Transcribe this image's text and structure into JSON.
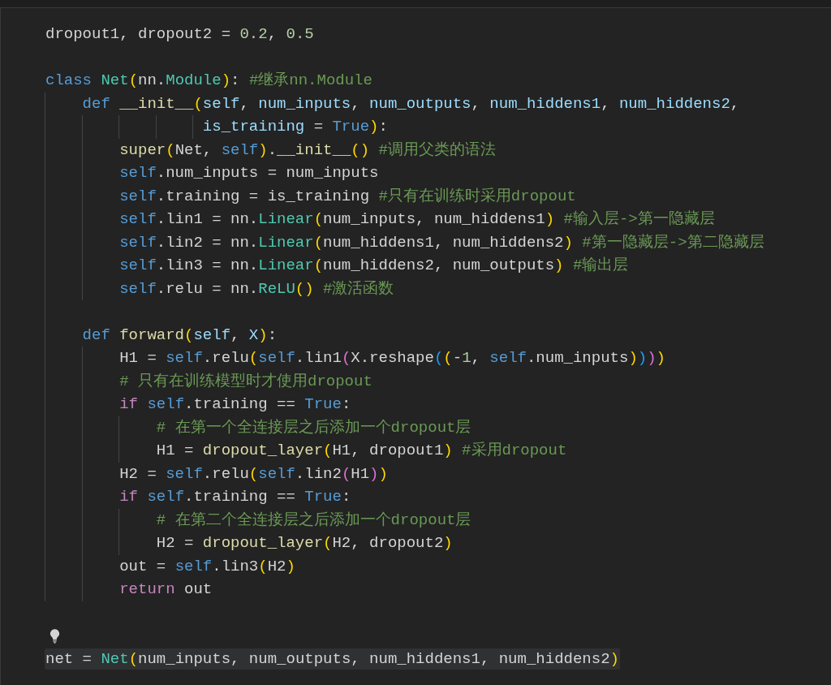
{
  "editor": {
    "lines": [
      {
        "kind": "code",
        "selected": false,
        "tokens": [
          {
            "text": "dropout1, dropout2 = ",
            "kind": "plain"
          },
          {
            "text": "0.2",
            "kind": "num"
          },
          {
            "text": ", ",
            "kind": "plain"
          },
          {
            "text": "0.5",
            "kind": "num"
          }
        ]
      },
      {
        "kind": "blank"
      },
      {
        "kind": "code",
        "selected": false,
        "tokens": [
          {
            "text": "class ",
            "kind": "kw"
          },
          {
            "text": "Net",
            "kind": "cls"
          },
          {
            "text": "(",
            "kind": "b1"
          },
          {
            "text": "nn.",
            "kind": "plain"
          },
          {
            "text": "Module",
            "kind": "cls"
          },
          {
            "text": ")",
            "kind": "b1"
          },
          {
            "text": ": ",
            "kind": "plain"
          },
          {
            "text": "#继承nn.Module",
            "kind": "cm"
          }
        ],
        "children": [
          {
            "kind": "code",
            "selected": false,
            "tokens": [
              {
                "text": "def ",
                "kind": "kw"
              },
              {
                "text": "__init__",
                "kind": "fn"
              },
              {
                "text": "(",
                "kind": "b1"
              },
              {
                "text": "self",
                "kind": "var"
              },
              {
                "text": ", ",
                "kind": "plain"
              },
              {
                "text": "num_inputs",
                "kind": "var"
              },
              {
                "text": ", ",
                "kind": "plain"
              },
              {
                "text": "num_outputs",
                "kind": "var"
              },
              {
                "text": ", ",
                "kind": "plain"
              },
              {
                "text": "num_hiddens1",
                "kind": "var"
              },
              {
                "text": ", ",
                "kind": "plain"
              },
              {
                "text": "num_hiddens2",
                "kind": "var"
              },
              {
                "text": ",",
                "kind": "plain"
              }
            ],
            "children": [
              {
                "kind": "continuation",
                "selected": false,
                "tokens": [
                  {
                    "text": "is_training",
                    "kind": "var"
                  },
                  {
                    "text": " = ",
                    "kind": "plain"
                  },
                  {
                    "text": "True",
                    "kind": "kw"
                  },
                  {
                    "text": ")",
                    "kind": "b1"
                  },
                  {
                    "text": ":",
                    "kind": "plain"
                  }
                ]
              },
              {
                "kind": "code",
                "selected": false,
                "tokens": [
                  {
                    "text": "super",
                    "kind": "fn"
                  },
                  {
                    "text": "(",
                    "kind": "b1"
                  },
                  {
                    "text": "Net, ",
                    "kind": "plain"
                  },
                  {
                    "text": "self",
                    "kind": "kw"
                  },
                  {
                    "text": ")",
                    "kind": "b1"
                  },
                  {
                    "text": ".",
                    "kind": "plain"
                  },
                  {
                    "text": "__init__",
                    "kind": "fn"
                  },
                  {
                    "text": "() ",
                    "kind": "b1"
                  },
                  {
                    "text": "#调用父类的语法",
                    "kind": "cm"
                  }
                ]
              },
              {
                "kind": "code",
                "selected": false,
                "tokens": [
                  {
                    "text": "self",
                    "kind": "kw"
                  },
                  {
                    "text": ".num_inputs = num_inputs",
                    "kind": "plain"
                  }
                ]
              },
              {
                "kind": "code",
                "selected": false,
                "tokens": [
                  {
                    "text": "self",
                    "kind": "kw"
                  },
                  {
                    "text": ".training = is_training ",
                    "kind": "plain"
                  },
                  {
                    "text": "#只有在训练时采用dropout",
                    "kind": "cm"
                  }
                ]
              },
              {
                "kind": "code",
                "selected": false,
                "tokens": [
                  {
                    "text": "self",
                    "kind": "kw"
                  },
                  {
                    "text": ".lin1 = nn.",
                    "kind": "plain"
                  },
                  {
                    "text": "Linear",
                    "kind": "cls"
                  },
                  {
                    "text": "(",
                    "kind": "b1"
                  },
                  {
                    "text": "num_inputs, num_hiddens1",
                    "kind": "plain"
                  },
                  {
                    "text": ") ",
                    "kind": "b1"
                  },
                  {
                    "text": "#输入层->第一隐藏层",
                    "kind": "cm"
                  }
                ]
              },
              {
                "kind": "code",
                "selected": false,
                "tokens": [
                  {
                    "text": "self",
                    "kind": "kw"
                  },
                  {
                    "text": ".lin2 = nn.",
                    "kind": "plain"
                  },
                  {
                    "text": "Linear",
                    "kind": "cls"
                  },
                  {
                    "text": "(",
                    "kind": "b1"
                  },
                  {
                    "text": "num_hiddens1, num_hiddens2",
                    "kind": "plain"
                  },
                  {
                    "text": ") ",
                    "kind": "b1"
                  },
                  {
                    "text": "#第一隐藏层->第二隐藏层",
                    "kind": "cm"
                  }
                ]
              },
              {
                "kind": "code",
                "selected": false,
                "tokens": [
                  {
                    "text": "self",
                    "kind": "kw"
                  },
                  {
                    "text": ".lin3 = nn.",
                    "kind": "plain"
                  },
                  {
                    "text": "Linear",
                    "kind": "cls"
                  },
                  {
                    "text": "(",
                    "kind": "b1"
                  },
                  {
                    "text": "num_hiddens2, num_outputs",
                    "kind": "plain"
                  },
                  {
                    "text": ") ",
                    "kind": "b1"
                  },
                  {
                    "text": "#输出层",
                    "kind": "cm"
                  }
                ]
              },
              {
                "kind": "code",
                "selected": false,
                "tokens": [
                  {
                    "text": "self",
                    "kind": "kw"
                  },
                  {
                    "text": ".relu = nn.",
                    "kind": "plain"
                  },
                  {
                    "text": "ReLU",
                    "kind": "cls"
                  },
                  {
                    "text": "() ",
                    "kind": "b1"
                  },
                  {
                    "text": "#激活函数",
                    "kind": "cm"
                  }
                ]
              }
            ]
          },
          {
            "kind": "blank"
          },
          {
            "kind": "code",
            "selected": false,
            "tokens": [
              {
                "text": "def ",
                "kind": "kw"
              },
              {
                "text": "forward",
                "kind": "fn"
              },
              {
                "text": "(",
                "kind": "b1"
              },
              {
                "text": "self",
                "kind": "var"
              },
              {
                "text": ", ",
                "kind": "plain"
              },
              {
                "text": "X",
                "kind": "var"
              },
              {
                "text": ")",
                "kind": "b1"
              },
              {
                "text": ":",
                "kind": "plain"
              }
            ],
            "children": [
              {
                "kind": "code",
                "selected": false,
                "tokens": [
                  {
                    "text": "H1 = ",
                    "kind": "plain"
                  },
                  {
                    "text": "self",
                    "kind": "kw"
                  },
                  {
                    "text": ".relu",
                    "kind": "plain"
                  },
                  {
                    "text": "(",
                    "kind": "b1"
                  },
                  {
                    "text": "self",
                    "kind": "kw"
                  },
                  {
                    "text": ".lin1",
                    "kind": "plain"
                  },
                  {
                    "text": "(",
                    "kind": "b2"
                  },
                  {
                    "text": "X.reshape",
                    "kind": "plain"
                  },
                  {
                    "text": "(",
                    "kind": "b3"
                  },
                  {
                    "text": "(",
                    "kind": "b1"
                  },
                  {
                    "text": "-",
                    "kind": "plain"
                  },
                  {
                    "text": "1",
                    "kind": "num"
                  },
                  {
                    "text": ", ",
                    "kind": "plain"
                  },
                  {
                    "text": "self",
                    "kind": "kw"
                  },
                  {
                    "text": ".num_inputs",
                    "kind": "plain"
                  },
                  {
                    "text": ")",
                    "kind": "b1"
                  },
                  {
                    "text": ")",
                    "kind": "b3"
                  },
                  {
                    "text": ")",
                    "kind": "b2"
                  },
                  {
                    "text": ")",
                    "kind": "b1"
                  }
                ]
              },
              {
                "kind": "code",
                "selected": false,
                "tokens": [
                  {
                    "text": "# 只有在训练模型时才使用dropout",
                    "kind": "cm"
                  }
                ]
              },
              {
                "kind": "code",
                "selected": false,
                "tokens": [
                  {
                    "text": "if ",
                    "kind": "ctl"
                  },
                  {
                    "text": "self",
                    "kind": "kw"
                  },
                  {
                    "text": ".training == ",
                    "kind": "plain"
                  },
                  {
                    "text": "True",
                    "kind": "kw"
                  },
                  {
                    "text": ":",
                    "kind": "plain"
                  }
                ],
                "children": [
                  {
                    "kind": "code",
                    "selected": false,
                    "tokens": [
                      {
                        "text": "# 在第一个全连接层之后添加一个dropout层",
                        "kind": "cm"
                      }
                    ]
                  },
                  {
                    "kind": "code",
                    "selected": false,
                    "tokens": [
                      {
                        "text": "H1 = ",
                        "kind": "plain"
                      },
                      {
                        "text": "dropout_layer",
                        "kind": "fn"
                      },
                      {
                        "text": "(",
                        "kind": "b1"
                      },
                      {
                        "text": "H1, dropout1",
                        "kind": "plain"
                      },
                      {
                        "text": ") ",
                        "kind": "b1"
                      },
                      {
                        "text": "#采用dropout",
                        "kind": "cm"
                      }
                    ]
                  }
                ]
              },
              {
                "kind": "code",
                "selected": false,
                "tokens": [
                  {
                    "text": "H2 = ",
                    "kind": "plain"
                  },
                  {
                    "text": "self",
                    "kind": "kw"
                  },
                  {
                    "text": ".relu",
                    "kind": "plain"
                  },
                  {
                    "text": "(",
                    "kind": "b1"
                  },
                  {
                    "text": "self",
                    "kind": "kw"
                  },
                  {
                    "text": ".lin2",
                    "kind": "plain"
                  },
                  {
                    "text": "(",
                    "kind": "b2"
                  },
                  {
                    "text": "H1",
                    "kind": "plain"
                  },
                  {
                    "text": ")",
                    "kind": "b2"
                  },
                  {
                    "text": ")",
                    "kind": "b1"
                  }
                ]
              },
              {
                "kind": "code",
                "selected": false,
                "tokens": [
                  {
                    "text": "if ",
                    "kind": "ctl"
                  },
                  {
                    "text": "self",
                    "kind": "kw"
                  },
                  {
                    "text": ".training == ",
                    "kind": "plain"
                  },
                  {
                    "text": "True",
                    "kind": "kw"
                  },
                  {
                    "text": ":",
                    "kind": "plain"
                  }
                ],
                "children": [
                  {
                    "kind": "code",
                    "selected": false,
                    "tokens": [
                      {
                        "text": "# 在第二个全连接层之后添加一个dropout层",
                        "kind": "cm"
                      }
                    ]
                  },
                  {
                    "kind": "code",
                    "selected": false,
                    "tokens": [
                      {
                        "text": "H2 = ",
                        "kind": "plain"
                      },
                      {
                        "text": "dropout_layer",
                        "kind": "fn"
                      },
                      {
                        "text": "(",
                        "kind": "b1"
                      },
                      {
                        "text": "H2, dropout2",
                        "kind": "plain"
                      },
                      {
                        "text": ")",
                        "kind": "b1"
                      }
                    ]
                  }
                ]
              },
              {
                "kind": "code",
                "selected": false,
                "tokens": [
                  {
                    "text": "out = ",
                    "kind": "plain"
                  },
                  {
                    "text": "self",
                    "kind": "kw"
                  },
                  {
                    "text": ".lin3",
                    "kind": "plain"
                  },
                  {
                    "text": "(",
                    "kind": "b1"
                  },
                  {
                    "text": "H2",
                    "kind": "plain"
                  },
                  {
                    "text": ")",
                    "kind": "b1"
                  }
                ]
              },
              {
                "kind": "code",
                "selected": false,
                "tokens": [
                  {
                    "text": "return ",
                    "kind": "ctl"
                  },
                  {
                    "text": "out",
                    "kind": "plain"
                  }
                ]
              }
            ]
          }
        ]
      },
      {
        "kind": "blank"
      },
      {
        "kind": "lightbulb"
      },
      {
        "kind": "code",
        "selected": true,
        "tokens": [
          {
            "text": "net = ",
            "kind": "plain"
          },
          {
            "text": "Net",
            "kind": "cls"
          },
          {
            "text": "(",
            "kind": "b1"
          },
          {
            "text": "num_inputs, num_outputs, num_hiddens1, num_hiddens2",
            "kind": "plain"
          },
          {
            "text": ")",
            "kind": "b1"
          }
        ]
      }
    ]
  }
}
